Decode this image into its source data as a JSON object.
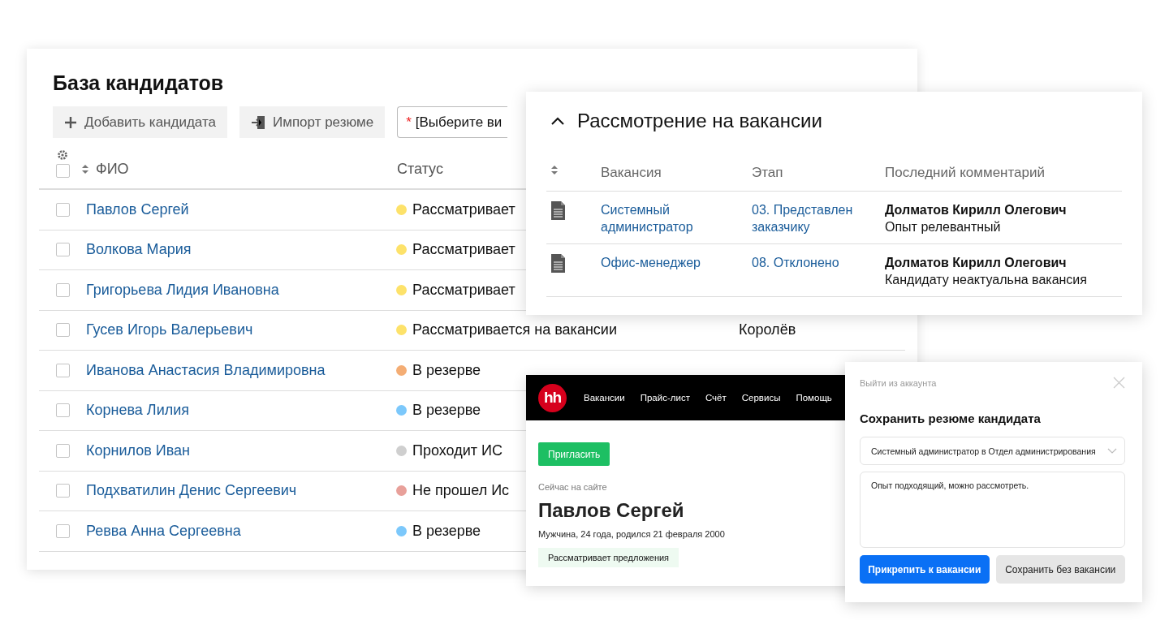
{
  "candidate_base": {
    "title": "База кандидатов",
    "actions": [
      {
        "label": "Добавить кандидата",
        "kind": "add"
      },
      {
        "label": "Импорт резюме",
        "kind": "import"
      }
    ],
    "vacancy_filter": {
      "required_mark": "*",
      "value": "[Выберите ви"
    },
    "select_all": {
      "checked": false
    },
    "columns": [
      "ФИО",
      "Статус"
    ],
    "rows": [
      {
        "name": "Павлов Сергей",
        "status": "Рассматривает",
        "color": "#fde26a",
        "checked": false
      },
      {
        "name": "Волкова Мария",
        "status": "Рассматривает",
        "color": "#fde26a",
        "checked": false
      },
      {
        "name": "Григорьева Лидия Ивановна",
        "status": "Рассматривает",
        "color": "#fde26a",
        "checked": false
      },
      {
        "name": "Гусев Игорь Валерьевич",
        "status": "Рассматривается на вакансии",
        "color": "#fde26a",
        "checked": false,
        "column_3": "Королёв"
      },
      {
        "name": "Иванова Анастасия Владимировна",
        "status": "В резерве",
        "color": "#f4ad74",
        "checked": false
      },
      {
        "name": "Корнева Лилия",
        "status": "В резерве",
        "color": "#7cc8fb",
        "checked": false
      },
      {
        "name": "Корнилов Иван",
        "status": "Проходит ИС",
        "color": "#cfcfcf",
        "checked": false
      },
      {
        "name": "Подхватилин Денис Сергеевич",
        "status": "Не прошел Ис",
        "color": "#e8a09a",
        "checked": false
      },
      {
        "name": "Ревва Анна Сергеевна",
        "status": "В резерве",
        "color": "#7cc8fb",
        "checked": false
      }
    ]
  },
  "vacancy_review": {
    "title": "Рассмотрение на вакансии",
    "expanded": true,
    "columns": [
      "Вакансия",
      "Этап",
      "Последний комментарий"
    ],
    "rows": [
      {
        "vacancy": "Системный администратор",
        "stage": "03. Представлен заказчику",
        "author": "Долматов Кирилл Олегович",
        "comment": "Опыт релевантный"
      },
      {
        "vacancy": "Офис-менеджер",
        "stage": "08. Отклонено",
        "author": "Долматов Кирилл Олегович",
        "comment": "Кандидату неактуальна вакансия"
      }
    ]
  },
  "resume_page": {
    "logo": "hh",
    "nav": [
      "Вакансии",
      "Прайс-лист",
      "Счёт",
      "Сервисы",
      "Помощь"
    ],
    "invite_button": "Пригласить",
    "presence": "Сейчас на сайте",
    "name": "Павлов Сергей",
    "details": "Мужчина, 24 года, родился 21 февраля 2000",
    "job_search_status": "Рассматривает предложения"
  },
  "save_dialog": {
    "logout_link": "Выйти из аккаунта",
    "title": "Сохранить резюме кандидата",
    "vacancy_select": "Системный администратор в Отдел администрирования",
    "comment": "Опыт подходящий, можно рассмотреть.",
    "buttons": [
      {
        "label": "Прикрепить к вакансии",
        "kind": "primary"
      },
      {
        "label": "Сохранить без вакансии",
        "kind": "secondary"
      }
    ]
  }
}
